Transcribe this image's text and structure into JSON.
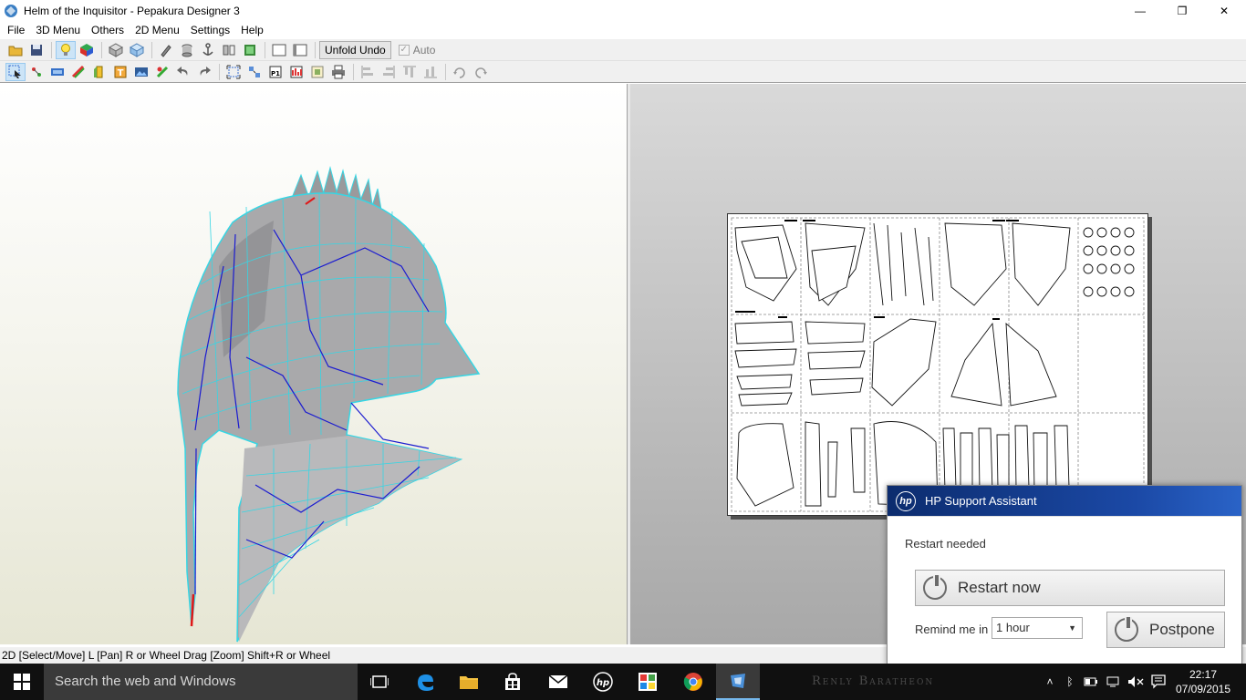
{
  "window": {
    "title": "Helm of the Inquisitor - Pepakura Designer 3",
    "minimize_glyph": "—",
    "maximize_glyph": "❐",
    "close_glyph": "✕"
  },
  "menu": {
    "items": [
      "File",
      "3D Menu",
      "Others",
      "2D Menu",
      "Settings",
      "Help"
    ]
  },
  "toolbar": {
    "unfold_undo_label": "Unfold Undo",
    "auto_label": "Auto",
    "auto_checked": true
  },
  "status": {
    "text": "2D [Select/Move] L [Pan] R or Wheel Drag [Zoom] Shift+R or Wheel"
  },
  "hp_popup": {
    "title": "HP Support Assistant",
    "logo_text": "hp",
    "message": "Restart needed",
    "restart_label": "Restart now",
    "remind_label": "Remind me in",
    "remind_value": "1 hour",
    "postpone_label": "Postpone"
  },
  "taskbar": {
    "search_placeholder": "Search the web and Windows",
    "wallpaper_text": "Renly Baratheon",
    "time": "22:17",
    "date": "07/09/2015"
  },
  "colors": {
    "mesh_edge": "#36d6e4",
    "fold_line": "#1b1bd0",
    "helmet_fill": "#a9a9ab",
    "hp_header": "#12398a"
  }
}
